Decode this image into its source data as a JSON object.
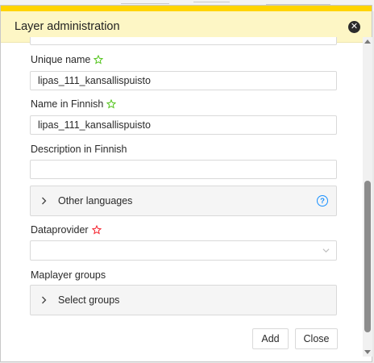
{
  "dialog": {
    "title": "Layer administration",
    "close_icon": "close-icon",
    "accent_color": "#ffd400",
    "header_bg": "#fdf6c5"
  },
  "form": {
    "top_field_value": "",
    "unique_name": {
      "label": "Unique name",
      "value": "lipas_111_kansallispuisto",
      "required_icon": "star-outline-green"
    },
    "name_fi": {
      "label": "Name in Finnish",
      "value": "lipas_111_kansallispuisto",
      "required_icon": "star-outline-green"
    },
    "description_fi": {
      "label": "Description in Finnish",
      "value": ""
    },
    "other_languages": {
      "label": "Other languages",
      "help_icon": "question-circle-icon"
    },
    "dataprovider": {
      "label": "Dataprovider",
      "value": "",
      "required_icon": "star-outline-red"
    },
    "maplayer_groups": {
      "label": "Maplayer groups",
      "panel_label": "Select groups"
    }
  },
  "buttons": {
    "add": "Add",
    "close": "Close"
  },
  "colors": {
    "star_valid": "#52c41a",
    "star_invalid": "#f5222d",
    "help": "#1890ff"
  }
}
